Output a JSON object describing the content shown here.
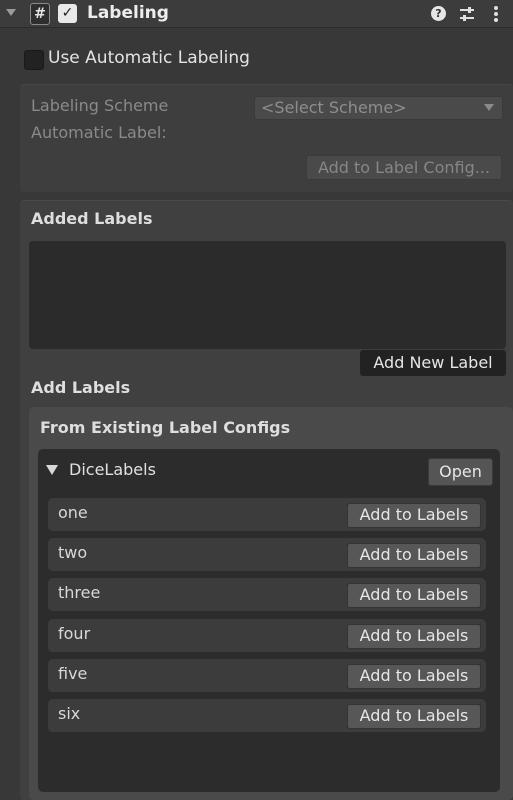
{
  "header": {
    "component_icon": "#",
    "enabled_mark": "✓",
    "title": "Labeling",
    "help_glyph": "?"
  },
  "automatic": {
    "checkbox_label": "Use Automatic Labeling",
    "scheme_label": "Labeling Scheme",
    "scheme_value": "<Select Scheme>",
    "auto_label_label": "Automatic Label:",
    "add_to_config_label": "Add to Label Config..."
  },
  "added_labels": {
    "title": "Added Labels",
    "add_new_label": "Add New Label"
  },
  "add_labels": {
    "title": "Add Labels",
    "existing_title": "From Existing Label Configs",
    "config": {
      "name": "DiceLabels",
      "open_label": "Open",
      "add_button_label": "Add to Labels",
      "labels": [
        "one",
        "two",
        "three",
        "four",
        "five",
        "six"
      ]
    }
  },
  "icons": {
    "fold": "triangle-down-icon",
    "component": "hash-icon",
    "enabled": "checkmark-icon",
    "help": "help-icon",
    "settings": "sliders-icon",
    "more": "more-vertical-icon"
  }
}
